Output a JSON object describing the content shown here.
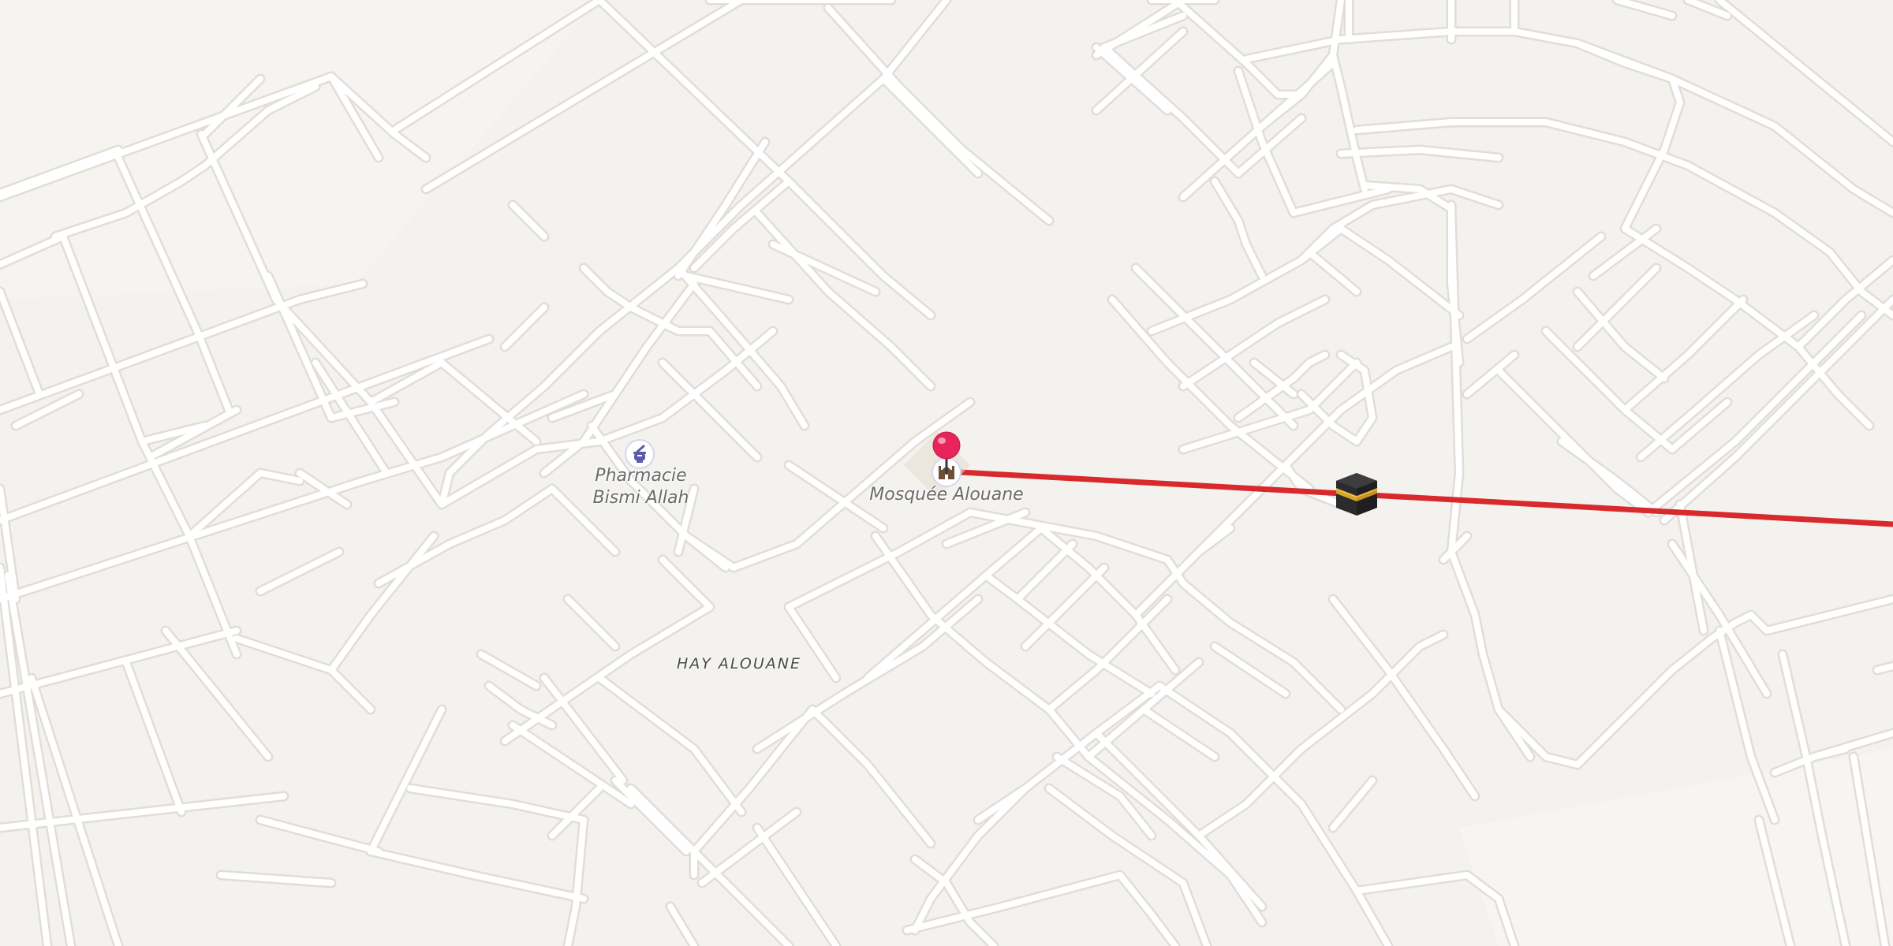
{
  "map": {
    "district_label": "HAY ALOUANE",
    "pois": [
      {
        "id": "pharmacy",
        "name_line1": "Pharmacie",
        "name_line2": "Bismi Allah",
        "icon": "pharmacy-mortar-icon"
      },
      {
        "id": "mosque",
        "name": "Mosquée Alouane",
        "icon": "mosque-icon"
      }
    ],
    "markers": {
      "location_pin": {
        "icon": "map-pin-icon",
        "color": "#e8245d"
      },
      "kaaba": {
        "icon": "kaaba-icon"
      }
    },
    "qibla_line": {
      "color": "#d8292c"
    },
    "colors": {
      "land": "#f4f2ef",
      "road": "#ffffff",
      "road_casing": "#e1ddd8",
      "poi_icon": "#5b5aa6"
    }
  }
}
